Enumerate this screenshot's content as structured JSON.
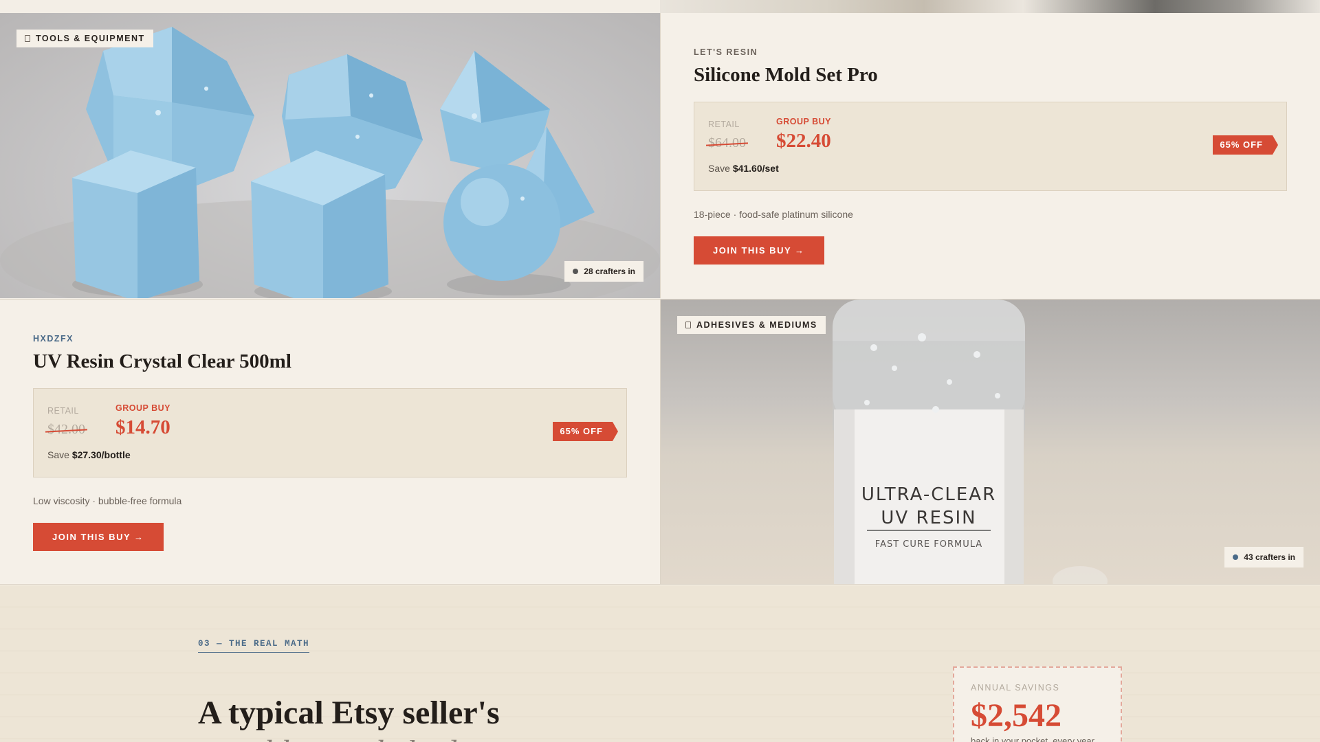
{
  "products": [
    {
      "category": "TOOLS & EQUIPMENT",
      "crafters": "28 crafters in",
      "brand": "LET'S RESIN",
      "title": "Silicone Mold Set Pro",
      "retail_label": "RETAIL",
      "retail_price": "$64.00",
      "groupbuy_label": "GROUP BUY",
      "groupbuy_price": "$22.40",
      "save_prefix": "Save",
      "save_amount": "$41.60/set",
      "discount": "65% OFF",
      "description": "18-piece · food-safe platinum silicone",
      "cta": "JOIN THIS BUY →"
    },
    {
      "category": "ADHESIVES & MEDIUMS",
      "crafters": "43 crafters in",
      "brand": "HXDZFX",
      "title": "UV Resin Crystal Clear 500ml",
      "retail_label": "RETAIL",
      "retail_price": "$42.00",
      "groupbuy_label": "GROUP BUY",
      "groupbuy_price": "$14.70",
      "save_prefix": "Save",
      "save_amount": "$27.30/bottle",
      "discount": "65% OFF",
      "description": "Low viscosity · bubble-free formula",
      "cta": "JOIN THIS BUY →"
    }
  ],
  "bottle_label": {
    "line1": "ULTRA-CLEAR",
    "line2": "UV RESIN",
    "line3": "FAST CURE FORMULA"
  },
  "section3": {
    "label": "03 — THE REAL MATH",
    "title": "A typical Etsy seller's",
    "subtitle": "monthly supply budget",
    "annual_label": "ANNUAL SAVINGS",
    "annual_value": "$2,542",
    "annual_sub": "back in your pocket, every year"
  },
  "colors": {
    "accent": "#d64b35",
    "blue": "#4a6a88",
    "background": "#f5f0e8"
  }
}
